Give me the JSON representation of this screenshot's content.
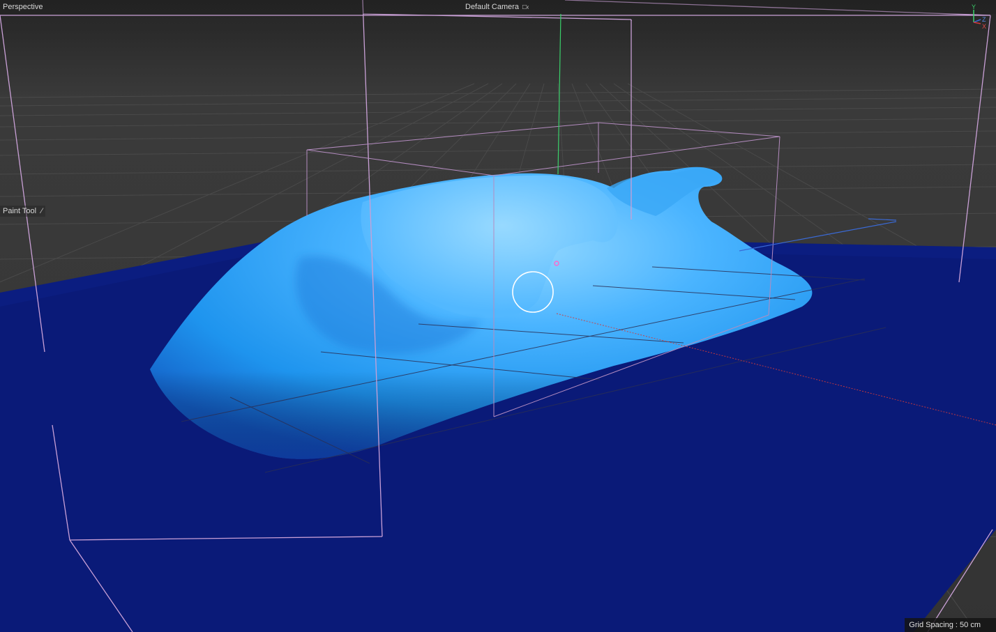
{
  "viewport": {
    "view_name": "Perspective",
    "camera_name": "Default Camera",
    "camera_icon": "camera-icon",
    "tool_label": "Paint Tool",
    "tool_icon": "brush-icon",
    "grid_spacing": "Grid Spacing : 50 cm",
    "axis_labels": {
      "x": "X",
      "y": "Y",
      "z": "Z"
    }
  },
  "colors": {
    "background": "#333333",
    "grid_line": "#4a4a4a",
    "water_plane": "#0a1a78",
    "wave_light": "#6cc6ff",
    "wave_mid": "#1e9af0",
    "bounding_box": "#c9a0d6",
    "axis_x": "#d23a3a",
    "axis_y": "#3ad06a",
    "axis_z": "#3a6ad6",
    "brush_cursor": "#ffffff"
  }
}
